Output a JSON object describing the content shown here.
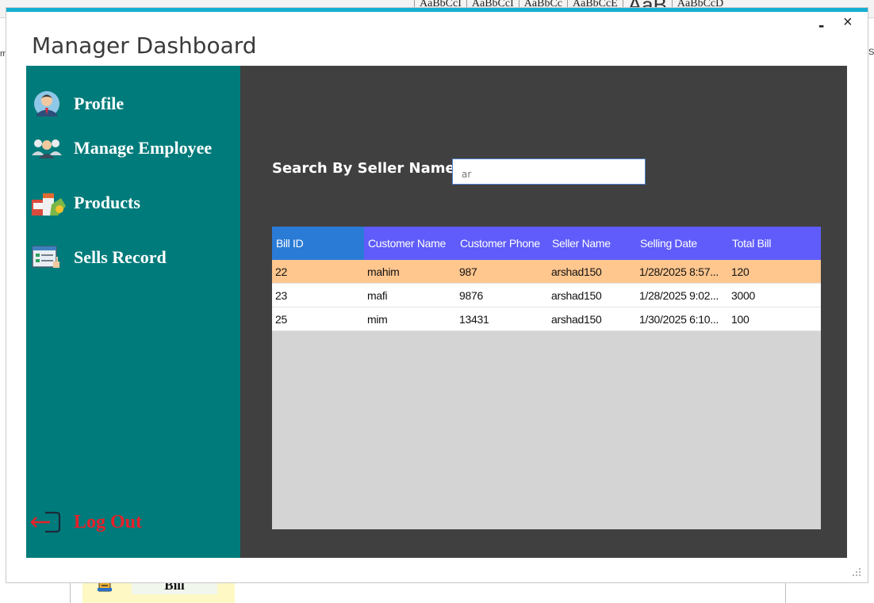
{
  "background": {
    "styles": [
      "AaBbCcI",
      "AaBbCcI",
      "AaBbCc",
      "AaBbCcE",
      "AaB",
      "AaBbCcD"
    ],
    "side_left": "m",
    "side_right": "IS",
    "bill_label": "Bill"
  },
  "window": {
    "title": "Manager Dashboard",
    "minimize": "-",
    "close": "×"
  },
  "sidebar": {
    "items": [
      {
        "label": "Profile"
      },
      {
        "label": "Manage Employee"
      },
      {
        "label": "Products"
      },
      {
        "label": "Sells Record"
      }
    ],
    "logout": "Log Out"
  },
  "search": {
    "label": "Search By Seller Name",
    "value": "ar"
  },
  "table": {
    "columns": [
      "Bill ID",
      "Customer Name",
      "Customer Phone",
      "Seller Name",
      "Selling Date",
      "Total Bill"
    ],
    "rows": [
      [
        "22",
        "mahim",
        "987",
        "arshad150",
        "1/28/2025 8:57...",
        "120"
      ],
      [
        "23",
        "mafi",
        "9876",
        "arshad150",
        "1/28/2025 9:02...",
        "3000"
      ],
      [
        "25",
        "mim",
        "13431",
        "arshad150",
        "1/30/2025 6:10...",
        "100"
      ]
    ],
    "selected_row": 0
  },
  "colors": {
    "sidebar": "#007b7b",
    "content": "#404040",
    "header": "#5f5cfb",
    "header_active": "#2a7bd6",
    "selected_row": "#ffc68e",
    "logout": "#e8202a",
    "accent": "#17aed3"
  }
}
